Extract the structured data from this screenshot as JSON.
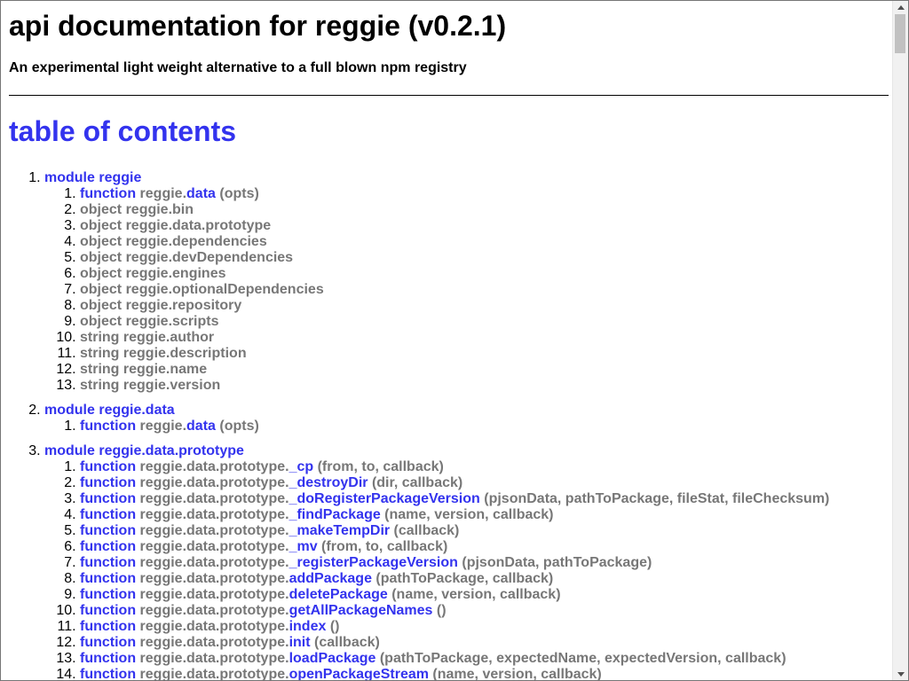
{
  "page": {
    "title": "api documentation for reggie (v0.2.1)",
    "subtitle": "An experimental light weight alternative to a full blown npm registry",
    "toc_heading": "table of contents"
  },
  "modules": [
    {
      "label": "module reggie",
      "members": [
        {
          "kw": "function",
          "path": "reggie.",
          "link": "data",
          "sig": " (opts)"
        },
        {
          "kw": "",
          "path": "object reggie.bin",
          "link": "",
          "sig": ""
        },
        {
          "kw": "",
          "path": "object reggie.data.prototype",
          "link": "",
          "sig": ""
        },
        {
          "kw": "",
          "path": "object reggie.dependencies",
          "link": "",
          "sig": ""
        },
        {
          "kw": "",
          "path": "object reggie.devDependencies",
          "link": "",
          "sig": ""
        },
        {
          "kw": "",
          "path": "object reggie.engines",
          "link": "",
          "sig": ""
        },
        {
          "kw": "",
          "path": "object reggie.optionalDependencies",
          "link": "",
          "sig": ""
        },
        {
          "kw": "",
          "path": "object reggie.repository",
          "link": "",
          "sig": ""
        },
        {
          "kw": "",
          "path": "object reggie.scripts",
          "link": "",
          "sig": ""
        },
        {
          "kw": "",
          "path": "string reggie.author",
          "link": "",
          "sig": ""
        },
        {
          "kw": "",
          "path": "string reggie.description",
          "link": "",
          "sig": ""
        },
        {
          "kw": "",
          "path": "string reggie.name",
          "link": "",
          "sig": ""
        },
        {
          "kw": "",
          "path": "string reggie.version",
          "link": "",
          "sig": ""
        }
      ]
    },
    {
      "label": "module reggie.data",
      "members": [
        {
          "kw": "function",
          "path": "reggie.",
          "link": "data",
          "sig": " (opts)"
        }
      ]
    },
    {
      "label": "module reggie.data.prototype",
      "members": [
        {
          "kw": "function",
          "path": "reggie.data.prototype.",
          "link": "_cp",
          "sig": " (from, to, callback)"
        },
        {
          "kw": "function",
          "path": "reggie.data.prototype.",
          "link": "_destroyDir",
          "sig": " (dir, callback)"
        },
        {
          "kw": "function",
          "path": "reggie.data.prototype.",
          "link": "_doRegisterPackageVersion",
          "sig": " (pjsonData, pathToPackage, fileStat, fileChecksum)"
        },
        {
          "kw": "function",
          "path": "reggie.data.prototype.",
          "link": "_findPackage",
          "sig": " (name, version, callback)"
        },
        {
          "kw": "function",
          "path": "reggie.data.prototype.",
          "link": "_makeTempDir",
          "sig": " (callback)"
        },
        {
          "kw": "function",
          "path": "reggie.data.prototype.",
          "link": "_mv",
          "sig": " (from, to, callback)"
        },
        {
          "kw": "function",
          "path": "reggie.data.prototype.",
          "link": "_registerPackageVersion",
          "sig": " (pjsonData, pathToPackage)"
        },
        {
          "kw": "function",
          "path": "reggie.data.prototype.",
          "link": "addPackage",
          "sig": " (pathToPackage, callback)"
        },
        {
          "kw": "function",
          "path": "reggie.data.prototype.",
          "link": "deletePackage",
          "sig": " (name, version, callback)"
        },
        {
          "kw": "function",
          "path": "reggie.data.prototype.",
          "link": "getAllPackageNames",
          "sig": " ()"
        },
        {
          "kw": "function",
          "path": "reggie.data.prototype.",
          "link": "index",
          "sig": " ()"
        },
        {
          "kw": "function",
          "path": "reggie.data.prototype.",
          "link": "init",
          "sig": " (callback)"
        },
        {
          "kw": "function",
          "path": "reggie.data.prototype.",
          "link": "loadPackage",
          "sig": " (pathToPackage, expectedName, expectedVersion, callback)"
        },
        {
          "kw": "function",
          "path": "reggie.data.prototype.",
          "link": "openPackageStream",
          "sig": " (name, version, callback)"
        }
      ]
    }
  ]
}
